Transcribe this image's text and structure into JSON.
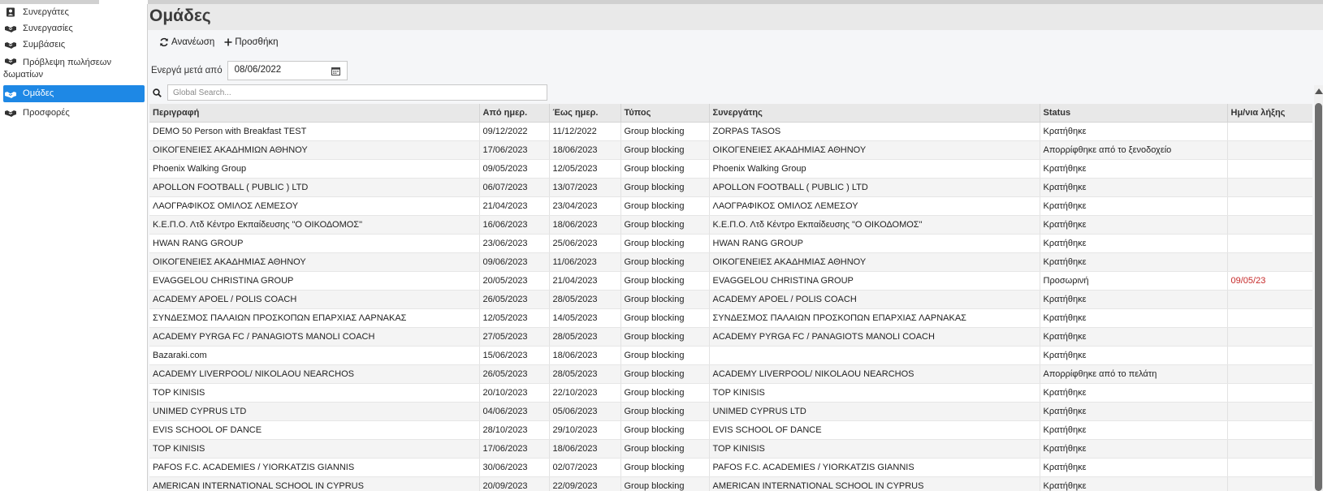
{
  "sidebar": {
    "items": [
      {
        "label": "Συνεργάτες",
        "icon": "contact-card-icon",
        "active": false
      },
      {
        "label": "Συνεργασίες",
        "icon": "handshake-icon",
        "active": false
      },
      {
        "label": "Συμβάσεις",
        "icon": "handshake-icon",
        "active": false
      },
      {
        "label": "Πρόβλεψη πωλήσεων δωματίων",
        "icon": "handshake-icon",
        "active": false
      },
      {
        "label": "Ομάδες",
        "icon": "handshake-icon",
        "active": true
      },
      {
        "label": "Προσφορές",
        "icon": "handshake-icon",
        "active": false
      }
    ]
  },
  "header": {
    "title": "Ομάδες"
  },
  "toolbar": {
    "refresh_label": "Ανανέωση",
    "add_label": "Προσθήκη"
  },
  "filter": {
    "label": "Ενεργά μετά από",
    "date_value": "08/06/2022"
  },
  "search": {
    "placeholder": "Global Search..."
  },
  "table": {
    "columns": [
      "Περιγραφή",
      "Από ημερ.",
      "Έως ημερ.",
      "Τύπος",
      "Συνεργάτης",
      "Status",
      "Ημ/νια λήξης"
    ],
    "rows": [
      [
        "DEMO 50 Person with Breakfast TEST",
        "09/12/2022",
        "11/12/2022",
        "Group blocking",
        "ZORPAS TASOS",
        "Κρατήθηκε",
        ""
      ],
      [
        "ΟΙΚΟΓΕΝΕΙΕΣ ΑΚΑΔΗΜΙΩΝ ΑΘΗΝΟΥ",
        "17/06/2023",
        "18/06/2023",
        "Group blocking",
        "ΟΙΚΟΓΕΝΕΙΕΣ ΑΚΑΔΗΜΙΑΣ ΑΘΗΝΟΥ",
        "Απορρίφθηκε από το ξενοδοχείο",
        ""
      ],
      [
        "Phoenix Walking Group",
        "09/05/2023",
        "12/05/2023",
        "Group blocking",
        "Phoenix Walking Group",
        "Κρατήθηκε",
        ""
      ],
      [
        "APOLLON FOOTBALL ( PUBLIC ) LTD",
        "06/07/2023",
        "13/07/2023",
        "Group blocking",
        "APOLLON FOOTBALL ( PUBLIC ) LTD",
        "Κρατήθηκε",
        ""
      ],
      [
        "ΛΑΟΓΡΑΦΙΚΟΣ ΟΜΙΛΟΣ ΛΕΜΕΣΟΥ",
        "21/04/2023",
        "23/04/2023",
        "Group blocking",
        "ΛΑΟΓΡΑΦΙΚΟΣ ΟΜΙΛΟΣ ΛΕΜΕΣΟΥ",
        "Κρατήθηκε",
        ""
      ],
      [
        "Κ.Ε.Π.Ο. Λτδ Κέντρο Εκπαίδευσης \"Ο ΟΙΚΟΔΟΜΟΣ\"",
        "16/06/2023",
        "18/06/2023",
        "Group blocking",
        "Κ.Ε.Π.Ο. Λτδ Κέντρο Εκπαίδευσης \"Ο ΟΙΚΟΔΟΜΟΣ\"",
        "Κρατήθηκε",
        ""
      ],
      [
        "HWAN RANG GROUP",
        "23/06/2023",
        "25/06/2023",
        "Group blocking",
        "HWAN RANG GROUP",
        "Κρατήθηκε",
        ""
      ],
      [
        "ΟΙΚΟΓΕΝΕΙΕΣ ΑΚΑΔΗΜΙΑΣ ΑΘΗΝΟΥ",
        "09/06/2023",
        "11/06/2023",
        "Group blocking",
        "ΟΙΚΟΓΕΝΕΙΕΣ ΑΚΑΔΗΜΙΑΣ ΑΘΗΝΟΥ",
        "Κρατήθηκε",
        ""
      ],
      [
        "EVAGGELOU CHRISTINA GROUP",
        "20/05/2023",
        "21/04/2023",
        "Group blocking",
        "EVAGGELOU CHRISTINA GROUP",
        "Προσωρινή",
        "09/05/23"
      ],
      [
        "ACADEMY APOEL / POLIS COACH",
        "26/05/2023",
        "28/05/2023",
        "Group blocking",
        "ACADEMY APOEL / POLIS COACH",
        "Κρατήθηκε",
        ""
      ],
      [
        "ΣΥΝΔΕΣΜΟΣ ΠΑΛΑΙΩΝ ΠΡΟΣΚΟΠΩΝ ΕΠΑΡΧΙΑΣ ΛΑΡΝΑΚΑΣ",
        "12/05/2023",
        "14/05/2023",
        "Group blocking",
        "ΣΥΝΔΕΣΜΟΣ ΠΑΛΑΙΩΝ ΠΡΟΣΚΟΠΩΝ ΕΠΑΡΧΙΑΣ ΛΑΡΝΑΚΑΣ",
        "Κρατήθηκε",
        ""
      ],
      [
        "ACADEMY PYRGA FC / PANAGIOTS MANOLI COACH",
        "27/05/2023",
        "28/05/2023",
        "Group blocking",
        "ACADEMY PYRGA FC / PANAGIOTS MANOLI COACH",
        "Κρατήθηκε",
        ""
      ],
      [
        "Bazaraki.com",
        "15/06/2023",
        "18/06/2023",
        "Group blocking",
        "",
        "Κρατήθηκε",
        ""
      ],
      [
        "ACADEMY LIVERPOOL/ NIKOLAOU NEARCHOS",
        "26/05/2023",
        "28/05/2023",
        "Group blocking",
        "ACADEMY LIVERPOOL/ NIKOLAOU NEARCHOS",
        "Απορρίφθηκε από το πελάτη",
        ""
      ],
      [
        "TOP KINISIS",
        "20/10/2023",
        "22/10/2023",
        "Group blocking",
        "TOP KINISIS",
        "Κρατήθηκε",
        ""
      ],
      [
        "UNIMED CYPRUS LTD",
        "04/06/2023",
        "05/06/2023",
        "Group blocking",
        "UNIMED CYPRUS LTD",
        "Κρατήθηκε",
        ""
      ],
      [
        "EVIS SCHOOL OF DANCE",
        "28/10/2023",
        "29/10/2023",
        "Group blocking",
        "EVIS SCHOOL OF DANCE",
        "Κρατήθηκε",
        ""
      ],
      [
        "TOP KINISIS",
        "17/06/2023",
        "18/06/2023",
        "Group blocking",
        "TOP KINISIS",
        "Κρατήθηκε",
        ""
      ],
      [
        "PAFOS F.C. ACADEMIES / YIORKATZIS GIANNIS",
        "30/06/2023",
        "02/07/2023",
        "Group blocking",
        "PAFOS F.C. ACADEMIES / YIORKATZIS GIANNIS",
        "Κρατήθηκε",
        ""
      ],
      [
        "AMERICAN INTERNATIONAL SCHOOL IN CYPRUS",
        "20/09/2023",
        "22/09/2023",
        "Group blocking",
        "AMERICAN INTERNATIONAL SCHOOL IN CYPRUS",
        "Κρατήθηκε",
        ""
      ]
    ]
  },
  "colors": {
    "accent": "#1e88e5",
    "expire_date": "#c62828",
    "header_bg": "#e8e8e8"
  }
}
